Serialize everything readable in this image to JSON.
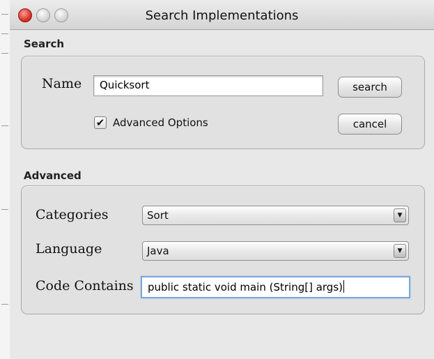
{
  "window": {
    "title": "Search Implementations"
  },
  "search": {
    "section_label": "Search",
    "name_label": "Name",
    "name_value": "Quicksort",
    "search_button": "search",
    "advanced_checkbox_label": "Advanced Options",
    "advanced_checked": true,
    "cancel_button": "cancel"
  },
  "advanced": {
    "section_label": "Advanced",
    "categories_label": "Categories",
    "categories_value": "Sort",
    "language_label": "Language",
    "language_value": "Java",
    "code_contains_label": "Code Contains",
    "code_contains_value": "public static void main (String[] args)"
  }
}
